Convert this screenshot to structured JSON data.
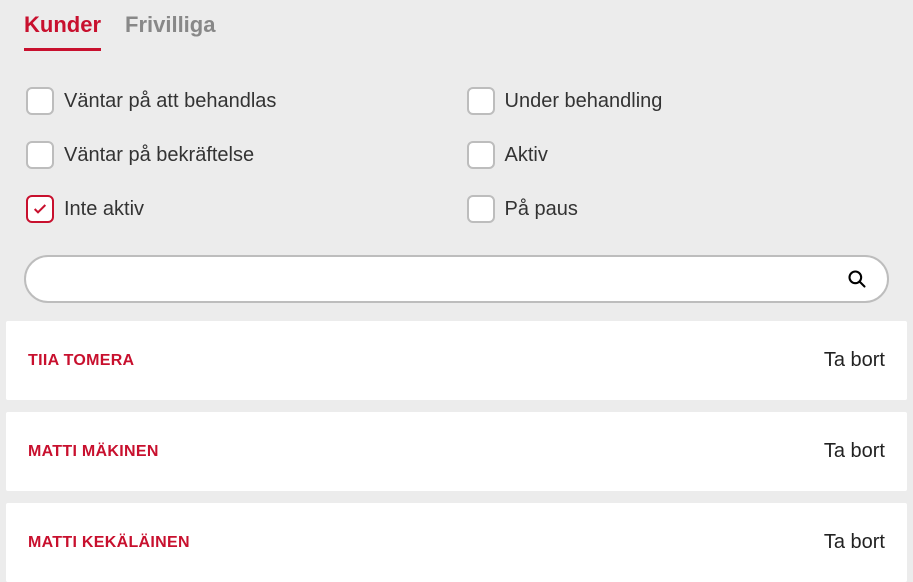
{
  "tabs": [
    {
      "label": "Kunder",
      "active": true
    },
    {
      "label": "Frivilliga",
      "active": false
    }
  ],
  "filters": [
    {
      "label": "Väntar på att behandlas",
      "checked": false
    },
    {
      "label": "Under behandling",
      "checked": false
    },
    {
      "label": "Väntar på bekräftelse",
      "checked": false
    },
    {
      "label": "Aktiv",
      "checked": false
    },
    {
      "label": "Inte aktiv",
      "checked": true
    },
    {
      "label": "På paus",
      "checked": false
    }
  ],
  "search": {
    "value": ""
  },
  "list": {
    "action_label": "Ta bort",
    "items": [
      {
        "name": "TIIA TOMERA"
      },
      {
        "name": "MATTI MÄKINEN"
      },
      {
        "name": "MATTI KEKÄLÄINEN"
      }
    ]
  },
  "colors": {
    "accent": "#c8102e"
  }
}
